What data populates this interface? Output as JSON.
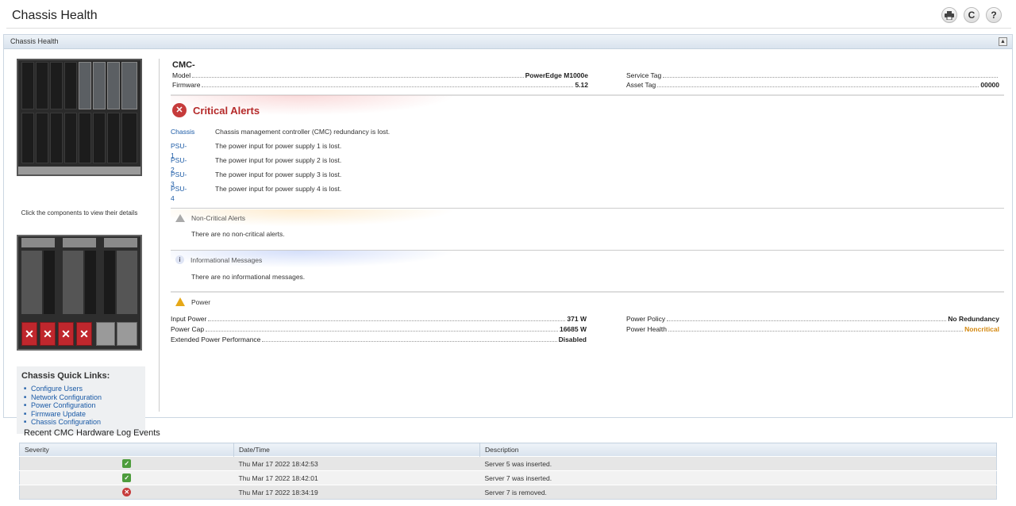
{
  "page": {
    "title": "Chassis Health"
  },
  "toolbar": {
    "print_icon": "print-icon",
    "refresh_icon": "refresh-icon",
    "help_icon": "help-icon"
  },
  "panel": {
    "title": "Chassis Health"
  },
  "left": {
    "click_note": "Click the components to view their details",
    "quick_links_title": "Chassis Quick Links:",
    "quick_links": [
      "Configure Users",
      "Network Configuration",
      "Power Configuration",
      "Firmware Update",
      "Chassis Configuration"
    ]
  },
  "cmc": {
    "name": "CMC-",
    "model_label": "Model",
    "model_value": "PowerEdge M1000e",
    "firmware_label": "Firmware",
    "firmware_value": "5.12",
    "service_tag_label": "Service Tag",
    "service_tag_value": "",
    "asset_tag_label": "Asset Tag",
    "asset_tag_value": "00000"
  },
  "critical": {
    "title": "Critical Alerts",
    "alerts": [
      {
        "source": "Chassis",
        "message": "Chassis management controller (CMC) redundancy is lost."
      },
      {
        "source": "PSU-1",
        "message": "The power input for power supply 1 is lost."
      },
      {
        "source": "PSU-2",
        "message": "The power input for power supply 2 is lost."
      },
      {
        "source": "PSU-3",
        "message": "The power input for power supply 3 is lost."
      },
      {
        "source": "PSU-4",
        "message": "The power input for power supply 4 is lost."
      }
    ]
  },
  "noncritical": {
    "title": "Non-Critical Alerts",
    "message": "There are no non-critical alerts."
  },
  "informational": {
    "title": "Informational Messages",
    "message": "There are no informational messages."
  },
  "power": {
    "title": "Power",
    "input_power_label": "Input Power",
    "input_power_value": "371 W",
    "power_cap_label": "Power Cap",
    "power_cap_value": "16685 W",
    "epp_label": "Extended Power Performance",
    "epp_value": "Disabled",
    "policy_label": "Power Policy",
    "policy_value": "No Redundancy",
    "health_label": "Power Health",
    "health_value": "Noncritical",
    "health_color": "#d4880f"
  },
  "log": {
    "title": "Recent CMC Hardware Log Events",
    "columns": [
      "Severity",
      "Date/Time",
      "Description"
    ],
    "rows": [
      {
        "severity": "ok",
        "datetime": "Thu Mar 17 2022 18:42:53",
        "description": "Server 5 was inserted."
      },
      {
        "severity": "ok",
        "datetime": "Thu Mar 17 2022 18:42:01",
        "description": "Server 7 was inserted."
      },
      {
        "severity": "critical",
        "datetime": "Thu Mar 17 2022 18:34:19",
        "description": "Server 7 is removed."
      }
    ]
  }
}
